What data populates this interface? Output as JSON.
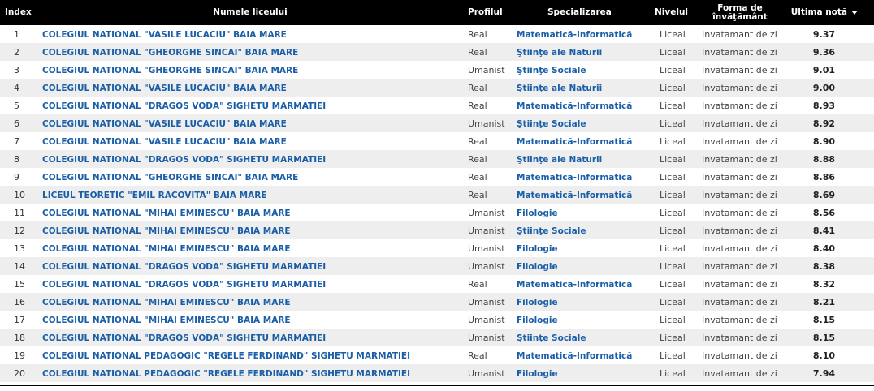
{
  "headers": {
    "index": "Index",
    "name": "Numele liceului",
    "profile": "Profilul",
    "specialization": "Specializarea",
    "level": "Nivelul",
    "form_line1": "Forma de",
    "form_line2": "învăţământ",
    "last_grade": "Ultima notă"
  },
  "rows": [
    {
      "index": "1",
      "name": "COLEGIUL NATIONAL \"VASILE LUCACIU\" BAIA MARE",
      "profile": "Real",
      "spec": "Matematică-Informatică",
      "level": "Liceal",
      "form": "Invatamant de zi",
      "grade": "9.37"
    },
    {
      "index": "2",
      "name": "COLEGIUL NATIONAL \"GHEORGHE SINCAI\" BAIA MARE",
      "profile": "Real",
      "spec": "Ştiinţe ale Naturii",
      "level": "Liceal",
      "form": "Invatamant de zi",
      "grade": "9.36"
    },
    {
      "index": "3",
      "name": "COLEGIUL NATIONAL \"GHEORGHE SINCAI\" BAIA MARE",
      "profile": "Umanist",
      "spec": "Ştiinţe Sociale",
      "level": "Liceal",
      "form": "Invatamant de zi",
      "grade": "9.01"
    },
    {
      "index": "4",
      "name": "COLEGIUL NATIONAL \"VASILE LUCACIU\" BAIA MARE",
      "profile": "Real",
      "spec": "Ştiinţe ale Naturii",
      "level": "Liceal",
      "form": "Invatamant de zi",
      "grade": "9.00"
    },
    {
      "index": "5",
      "name": "COLEGIUL NATIONAL \"DRAGOS VODA\" SIGHETU MARMATIEI",
      "profile": "Real",
      "spec": "Matematică-Informatică",
      "level": "Liceal",
      "form": "Invatamant de zi",
      "grade": "8.93"
    },
    {
      "index": "6",
      "name": "COLEGIUL NATIONAL \"VASILE LUCACIU\" BAIA MARE",
      "profile": "Umanist",
      "spec": "Ştiinţe Sociale",
      "level": "Liceal",
      "form": "Invatamant de zi",
      "grade": "8.92"
    },
    {
      "index": "7",
      "name": "COLEGIUL NATIONAL \"VASILE LUCACIU\" BAIA MARE",
      "profile": "Real",
      "spec": "Matematică-Informatică",
      "level": "Liceal",
      "form": "Invatamant de zi",
      "grade": "8.90"
    },
    {
      "index": "8",
      "name": "COLEGIUL NATIONAL \"DRAGOS VODA\" SIGHETU MARMATIEI",
      "profile": "Real",
      "spec": "Ştiinţe ale Naturii",
      "level": "Liceal",
      "form": "Invatamant de zi",
      "grade": "8.88"
    },
    {
      "index": "9",
      "name": "COLEGIUL NATIONAL \"GHEORGHE SINCAI\" BAIA MARE",
      "profile": "Real",
      "spec": "Matematică-Informatică",
      "level": "Liceal",
      "form": "Invatamant de zi",
      "grade": "8.86"
    },
    {
      "index": "10",
      "name": "LICEUL TEORETIC \"EMIL RACOVITA\" BAIA MARE",
      "profile": "Real",
      "spec": "Matematică-Informatică",
      "level": "Liceal",
      "form": "Invatamant de zi",
      "grade": "8.69"
    },
    {
      "index": "11",
      "name": "COLEGIUL NATIONAL \"MIHAI EMINESCU\" BAIA MARE",
      "profile": "Umanist",
      "spec": "Filologie",
      "level": "Liceal",
      "form": "Invatamant de zi",
      "grade": "8.56"
    },
    {
      "index": "12",
      "name": "COLEGIUL NATIONAL \"MIHAI EMINESCU\" BAIA MARE",
      "profile": "Umanist",
      "spec": "Ştiinţe Sociale",
      "level": "Liceal",
      "form": "Invatamant de zi",
      "grade": "8.41"
    },
    {
      "index": "13",
      "name": "COLEGIUL NATIONAL \"MIHAI EMINESCU\" BAIA MARE",
      "profile": "Umanist",
      "spec": "Filologie",
      "level": "Liceal",
      "form": "Invatamant de zi",
      "grade": "8.40"
    },
    {
      "index": "14",
      "name": "COLEGIUL NATIONAL \"DRAGOS VODA\" SIGHETU MARMATIEI",
      "profile": "Umanist",
      "spec": "Filologie",
      "level": "Liceal",
      "form": "Invatamant de zi",
      "grade": "8.38"
    },
    {
      "index": "15",
      "name": "COLEGIUL NATIONAL \"DRAGOS VODA\" SIGHETU MARMATIEI",
      "profile": "Real",
      "spec": "Matematică-Informatică",
      "level": "Liceal",
      "form": "Invatamant de zi",
      "grade": "8.32"
    },
    {
      "index": "16",
      "name": "COLEGIUL NATIONAL \"MIHAI EMINESCU\" BAIA MARE",
      "profile": "Umanist",
      "spec": "Filologie",
      "level": "Liceal",
      "form": "Invatamant de zi",
      "grade": "8.21"
    },
    {
      "index": "17",
      "name": "COLEGIUL NATIONAL \"MIHAI EMINESCU\" BAIA MARE",
      "profile": "Umanist",
      "spec": "Filologie",
      "level": "Liceal",
      "form": "Invatamant de zi",
      "grade": "8.15"
    },
    {
      "index": "18",
      "name": "COLEGIUL NATIONAL \"DRAGOS VODA\" SIGHETU MARMATIEI",
      "profile": "Umanist",
      "spec": "Ştiinţe Sociale",
      "level": "Liceal",
      "form": "Invatamant de zi",
      "grade": "8.15"
    },
    {
      "index": "19",
      "name": "COLEGIUL NATIONAL PEDAGOGIC \"REGELE FERDINAND\" SIGHETU MARMATIEI",
      "profile": "Real",
      "spec": "Matematică-Informatică",
      "level": "Liceal",
      "form": "Invatamant de zi",
      "grade": "8.10"
    },
    {
      "index": "20",
      "name": "COLEGIUL NATIONAL PEDAGOGIC \"REGELE FERDINAND\" SIGHETU MARMATIEI",
      "profile": "Umanist",
      "spec": "Filologie",
      "level": "Liceal",
      "form": "Invatamant de zi",
      "grade": "7.94"
    }
  ],
  "colors": {
    "header_bg": "#000000",
    "link": "#1a5ea8",
    "row_alt": "#eeeeee"
  },
  "icons": {
    "sort": "sort-descending-icon"
  }
}
